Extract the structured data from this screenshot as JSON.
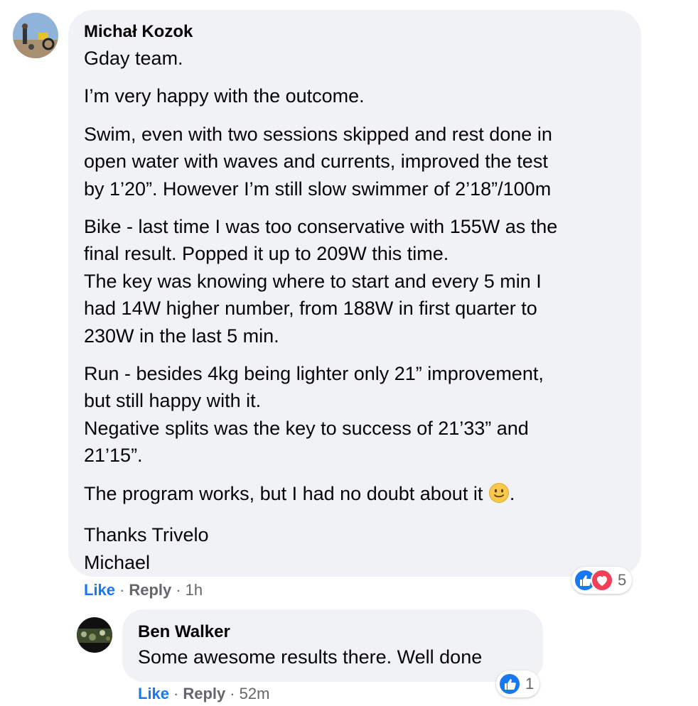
{
  "comment": {
    "author": "Michał Kozok",
    "paragraphs": [
      [
        "Gday team."
      ],
      [
        "I’m very happy with the outcome."
      ],
      [
        "Swim, even with two sessions skipped and rest done in",
        "open water with waves and currents, improved the test",
        "by 1’20”. However I’m still slow swimmer of 2’18”/100m"
      ],
      [
        "Bike - last time I was too conservative with 155W as the",
        "final result. Popped it up to 209W this time.",
        "The key was knowing where to start and every 5 min I",
        "had 14W higher number, from 188W in first quarter to",
        "230W in the last 5 min."
      ],
      [
        "Run - besides 4kg being lighter only 21” improvement,",
        "but still happy with it.",
        "Negative splits was the key to success of 21’33” and",
        "21’15”."
      ],
      [
        "The program works, but I had no doubt about it"
      ],
      [
        "Thanks Trivelo",
        "Michael"
      ]
    ],
    "emoji_suffix": ".",
    "emoji_name": "slightly-smiling-face-icon",
    "reaction_count": "5",
    "actions": {
      "like": "Like",
      "reply": "Reply",
      "time": "1h",
      "separator": "·"
    }
  },
  "reply": {
    "author": "Ben Walker",
    "text": "Some awesome results there. Well done",
    "reaction_count": "1",
    "actions": {
      "like": "Like",
      "reply": "Reply",
      "time": "52m",
      "separator": "·"
    }
  },
  "colors": {
    "link_blue": "#1877f2",
    "bubble_bg": "#f0f2f5",
    "muted": "#65676b",
    "love_red": "#f33e58"
  }
}
